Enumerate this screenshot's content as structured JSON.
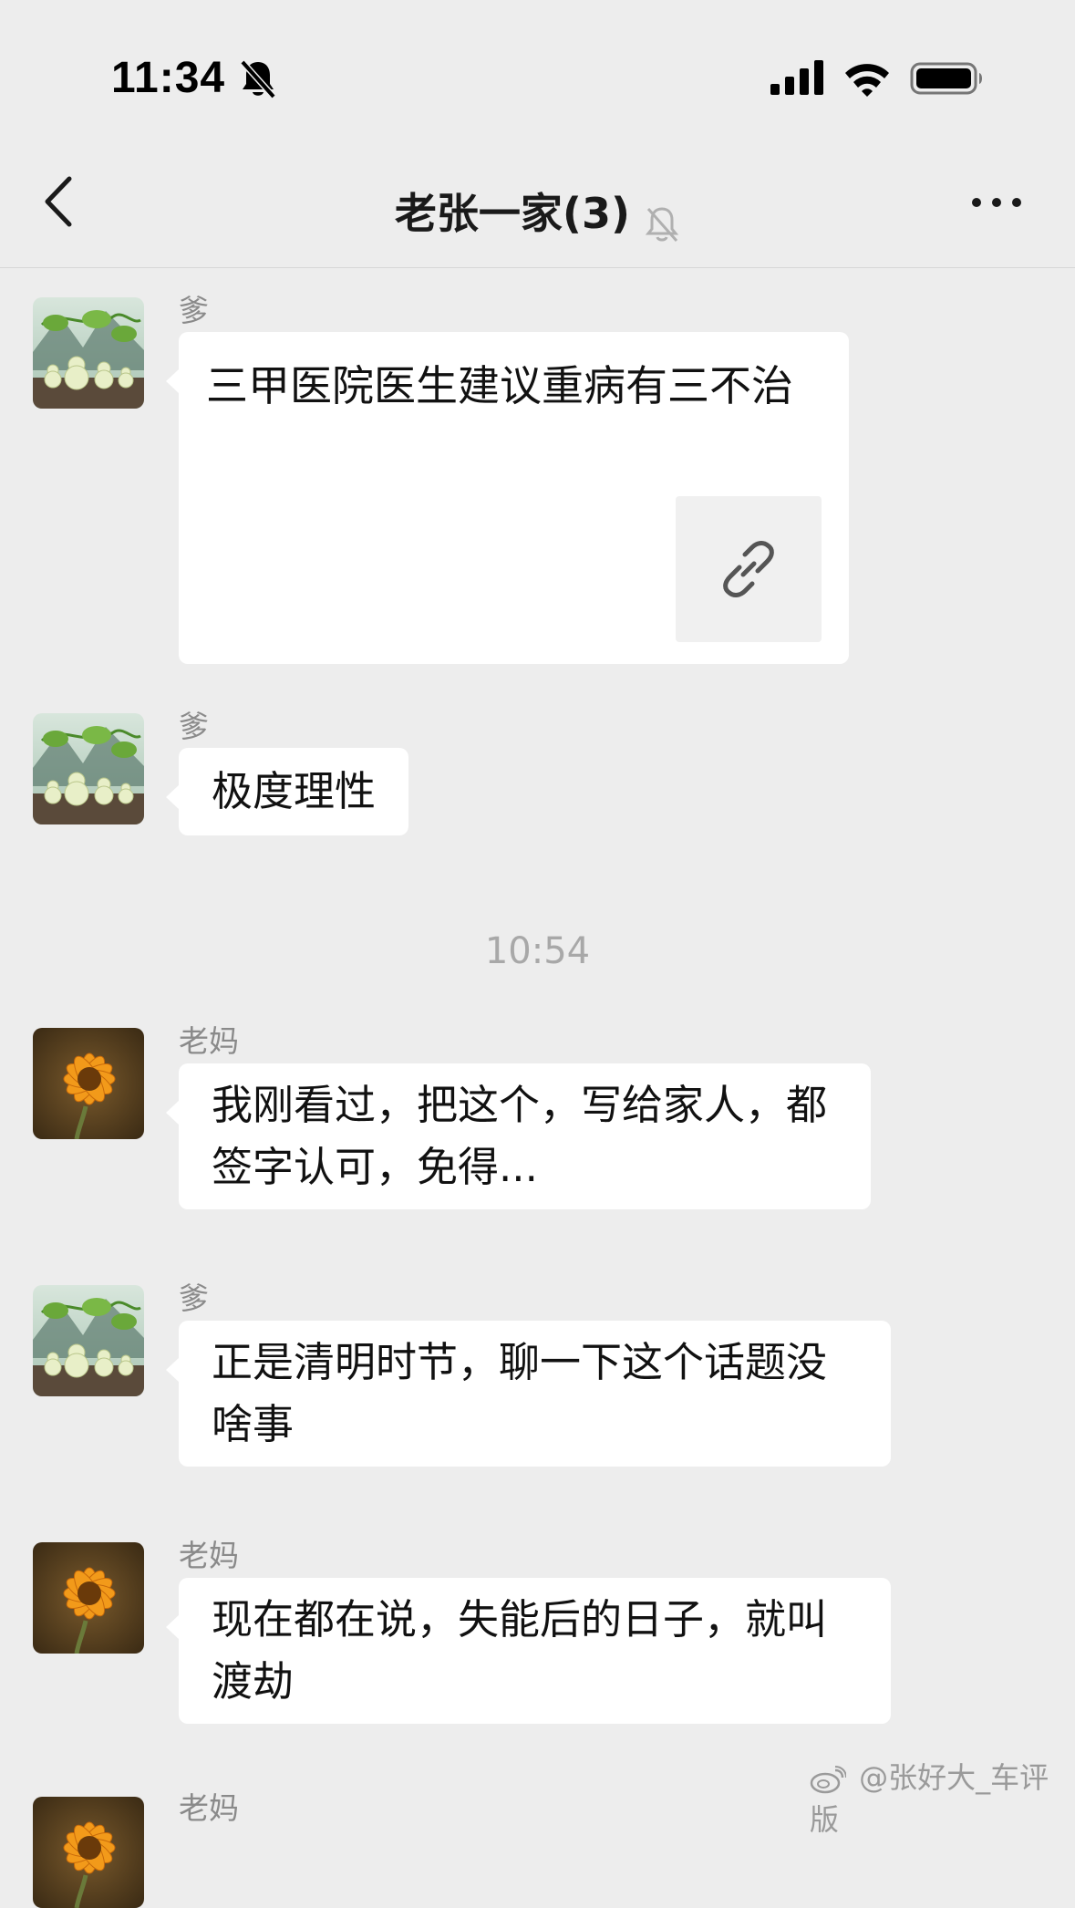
{
  "status_bar": {
    "time": "11:34",
    "icons": [
      "bell-slash-icon",
      "signal-icon",
      "wifi-icon",
      "battery-icon"
    ]
  },
  "header": {
    "title": "老张一家(3)",
    "icons": [
      "back-icon",
      "mute-icon",
      "more-icon"
    ]
  },
  "messages": [
    {
      "sender": "爹",
      "text": "三甲医院医生建议重病有三不治",
      "type": "link-card"
    },
    {
      "sender": "爹",
      "text": "极度理性"
    },
    {
      "sender": "老妈",
      "text": "我刚看过，把这个，写给家人，都签字认可，免得..."
    },
    {
      "sender": "爹",
      "text": "正是清明时节，聊一下这个话题没啥事"
    },
    {
      "sender": "老妈",
      "text": "现在都在说，失能后的日子，就叫渡劫"
    },
    {
      "sender": "老妈",
      "text": ""
    }
  ],
  "timestamp": "10:54",
  "watermark": "@张好大_车评版",
  "colors": {
    "background": "#ededed",
    "bubble": "#ffffff",
    "secondary_text": "#8a8a8a"
  }
}
